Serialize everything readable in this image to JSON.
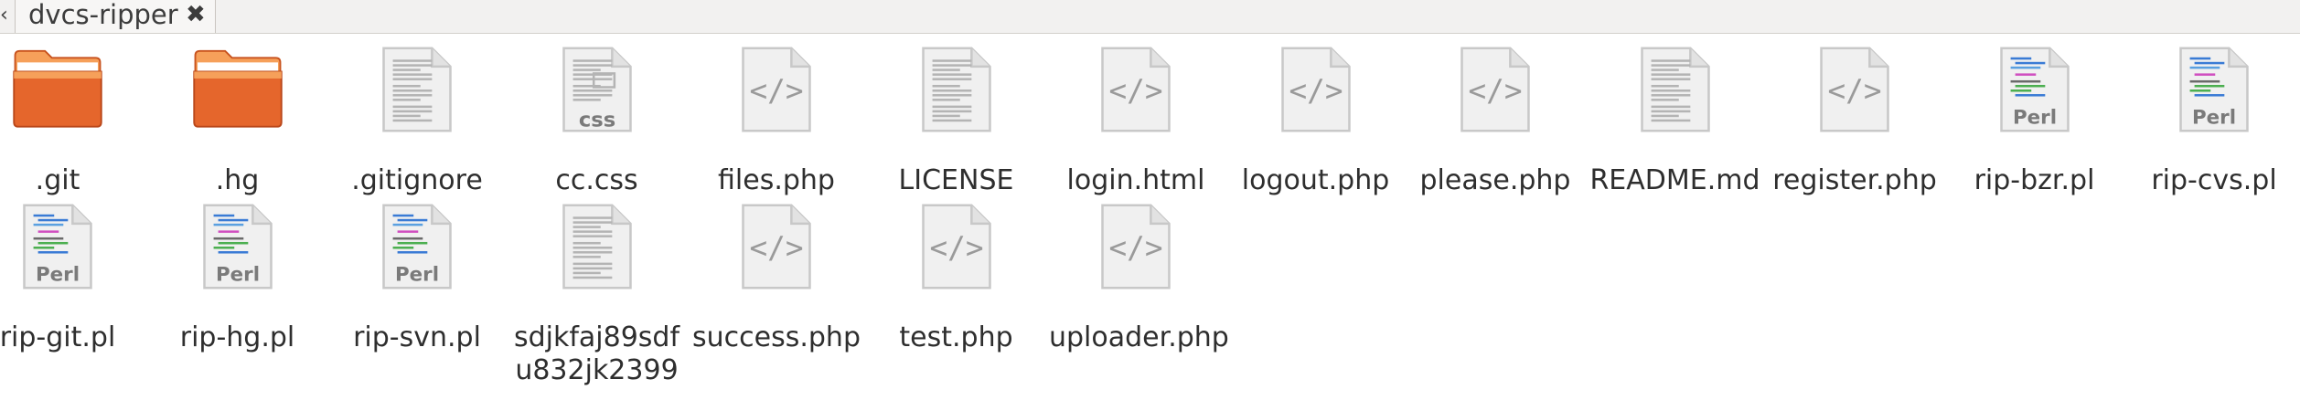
{
  "tab": {
    "title": "dvcs-ripper"
  },
  "files": [
    {
      "name": ".git",
      "kind": "folder"
    },
    {
      "name": ".hg",
      "kind": "folder"
    },
    {
      "name": ".gitignore",
      "kind": "text"
    },
    {
      "name": "cc.css",
      "kind": "css",
      "badge": "CSS"
    },
    {
      "name": "files.php",
      "kind": "code"
    },
    {
      "name": "LICENSE",
      "kind": "text"
    },
    {
      "name": "login.html",
      "kind": "code"
    },
    {
      "name": "logout.php",
      "kind": "code"
    },
    {
      "name": "please.php",
      "kind": "code"
    },
    {
      "name": "README.md",
      "kind": "text"
    },
    {
      "name": "register.php",
      "kind": "code"
    },
    {
      "name": "rip-bzr.pl",
      "kind": "perl",
      "badge": "Perl"
    },
    {
      "name": "rip-cvs.pl",
      "kind": "perl",
      "badge": "Perl"
    },
    {
      "name": "rip-git.pl",
      "kind": "perl",
      "badge": "Perl"
    },
    {
      "name": "rip-hg.pl",
      "kind": "perl",
      "badge": "Perl"
    },
    {
      "name": "rip-svn.pl",
      "kind": "perl",
      "badge": "Perl"
    },
    {
      "name": "sdjkfaj89sdfu832jk2399",
      "label_lines": [
        "sdjkfaj89sdf",
        "u832jk2399"
      ],
      "kind": "text"
    },
    {
      "name": "success.php",
      "kind": "code"
    },
    {
      "name": "test.php",
      "kind": "code"
    },
    {
      "name": "uploader.php",
      "kind": "code"
    }
  ],
  "colors": {
    "folder_top": "#f6a05a",
    "folder_body": "#e5662c",
    "paper": "#f0f0f0",
    "paper_edge": "#c8c8c8",
    "glyph": "#9a9a9a"
  }
}
